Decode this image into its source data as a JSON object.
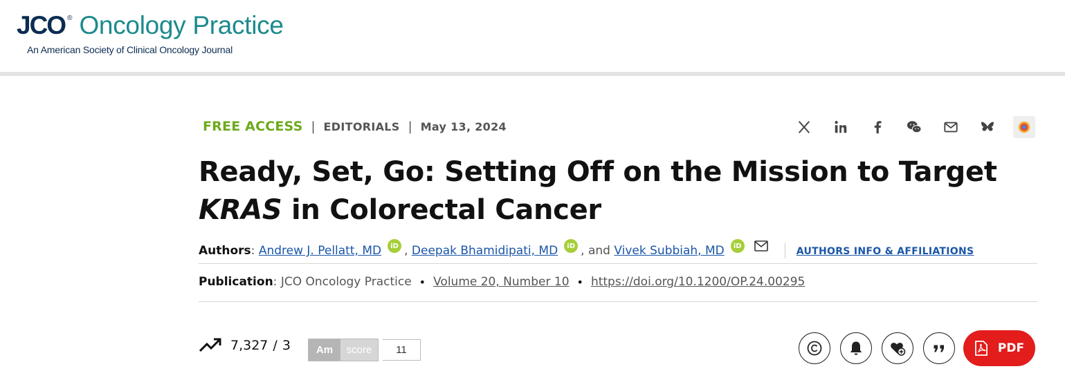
{
  "header": {
    "logo_abbr": "JCO",
    "logo_reg": "®",
    "journal_name": "Oncology Practice",
    "tagline": "An American Society of Clinical Oncology Journal"
  },
  "article_meta": {
    "access": "FREE ACCESS",
    "separator": "|",
    "category": "EDITORIALS",
    "date": "May 13, 2024"
  },
  "share_icons": [
    "x-icon",
    "linkedin-icon",
    "facebook-icon",
    "wechat-icon",
    "email-icon",
    "bluesky-icon",
    "altmetric-icon"
  ],
  "title": {
    "part1": "Ready, Set, Go: Setting Off on the Mission to Target ",
    "italic": "KRAS",
    "part2": " in Colorectal Cancer"
  },
  "authors": {
    "label": "Authors",
    "colon": ":",
    "list": [
      {
        "name": "Andrew J. Pellatt, MD"
      },
      {
        "name": "Deepak Bhamidipati, MD"
      },
      {
        "name": "Vivek Subbiah, MD"
      }
    ],
    "comma": ",",
    "and_text": ", and",
    "orcid_label": "iD",
    "info_link": "AUTHORS INFO & AFFILIATIONS"
  },
  "publication": {
    "label": "Publication",
    "colon": ":",
    "journal": "JCO Oncology Practice",
    "bullet": "•",
    "volume": "Volume 20, Number 10",
    "doi": "https://doi.org/10.1200/OP.24.00295"
  },
  "metrics": {
    "downloads": "7,327",
    "slash": "/",
    "citations": "3",
    "altmetric_am": "Am",
    "altmetric_label": "score",
    "altmetric_score": "11"
  },
  "actions": {
    "pdf_label": "PDF"
  },
  "colors": {
    "free_access": "#6cab1b",
    "link": "#1a56a8",
    "pdf_button": "#e31c1c",
    "brand_teal": "#1b8a8d",
    "brand_navy": "#0c2d52",
    "orcid": "#a6ce39"
  }
}
